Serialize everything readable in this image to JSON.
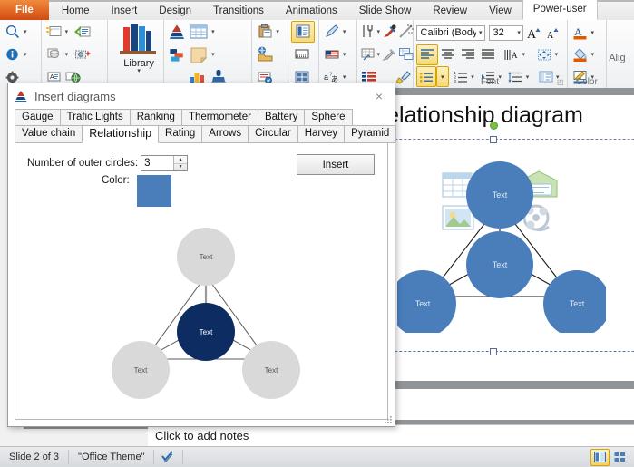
{
  "app": {
    "ribbon_tabs": [
      {
        "label": "File",
        "type": "file"
      },
      {
        "label": "Home",
        "type": "normal"
      },
      {
        "label": "Insert",
        "type": "normal"
      },
      {
        "label": "Design",
        "type": "normal"
      },
      {
        "label": "Transitions",
        "type": "normal"
      },
      {
        "label": "Animations",
        "type": "normal"
      },
      {
        "label": "Slide Show",
        "type": "normal"
      },
      {
        "label": "Review",
        "type": "normal"
      },
      {
        "label": "View",
        "type": "normal"
      },
      {
        "label": "Power-user",
        "type": "active"
      }
    ],
    "ribbon_groups": [
      {
        "name": "tools-group",
        "label": ""
      },
      {
        "name": "slides-group",
        "label": ""
      },
      {
        "name": "library-group",
        "label": "Library"
      },
      {
        "name": "diagrams-group",
        "label": ""
      },
      {
        "name": "paste-group",
        "label": ""
      },
      {
        "name": "text-group",
        "label": ""
      },
      {
        "name": "utilities-group",
        "label": ""
      },
      {
        "name": "font-group",
        "label": "Font"
      },
      {
        "name": "color-group",
        "label": "Color"
      },
      {
        "name": "align-group",
        "label": "Alig"
      }
    ],
    "font_name": "Calibri (Body)",
    "font_size": "32",
    "library_label": "Library",
    "font_group_label": "Font",
    "color_group_label": "Color",
    "align_group_label": "Alig"
  },
  "slide": {
    "title": "Relationship diagram",
    "node_label": "Text",
    "nodes": [
      {
        "id": "top",
        "label": "Text"
      },
      {
        "id": "center",
        "label": "Text"
      },
      {
        "id": "bottom-left",
        "label": "Text"
      },
      {
        "id": "bottom-right",
        "label": "Text"
      }
    ],
    "node_color": "#4a7ebb",
    "placeholder_icons": [
      "table-icon",
      "chart-icon",
      "smartart-icon",
      "picture-icon",
      "clipart-icon",
      "media-icon"
    ]
  },
  "notes": {
    "placeholder": "Click to add notes"
  },
  "statusbar": {
    "slide_indicator": "Slide 2 of 3",
    "theme": "\"Office Theme\"",
    "spellcheck_icon": "spellcheck-icon",
    "views": [
      {
        "name": "normal-view",
        "icon": "normal-view-icon",
        "active": true
      },
      {
        "name": "slide-sorter-view",
        "icon": "slide-sorter-icon",
        "active": false
      }
    ]
  },
  "dialog": {
    "title": "Insert diagrams",
    "title_icon": "pyramid-icon",
    "close_label": "×",
    "tabs_row1": [
      "Gauge",
      "Trafic Lights",
      "Ranking",
      "Thermometer",
      "Battery",
      "Sphere"
    ],
    "tabs_row2": [
      "Value chain",
      "Relationship",
      "Rating",
      "Arrows",
      "Circular",
      "Harvey",
      "Pyramid"
    ],
    "active_tab": "Relationship",
    "form": {
      "outer_circles_label": "Number of outer circles:",
      "outer_circles_value": "3",
      "color_label": "Color:",
      "color_value": "#4a7ebb",
      "insert_label": "Insert"
    },
    "preview": {
      "center_color": "#0d2c61",
      "outer_color": "#d9d9d9",
      "node_label": "Text",
      "center_text_color": "#ffffff",
      "outer_text_color": "#555555"
    }
  }
}
